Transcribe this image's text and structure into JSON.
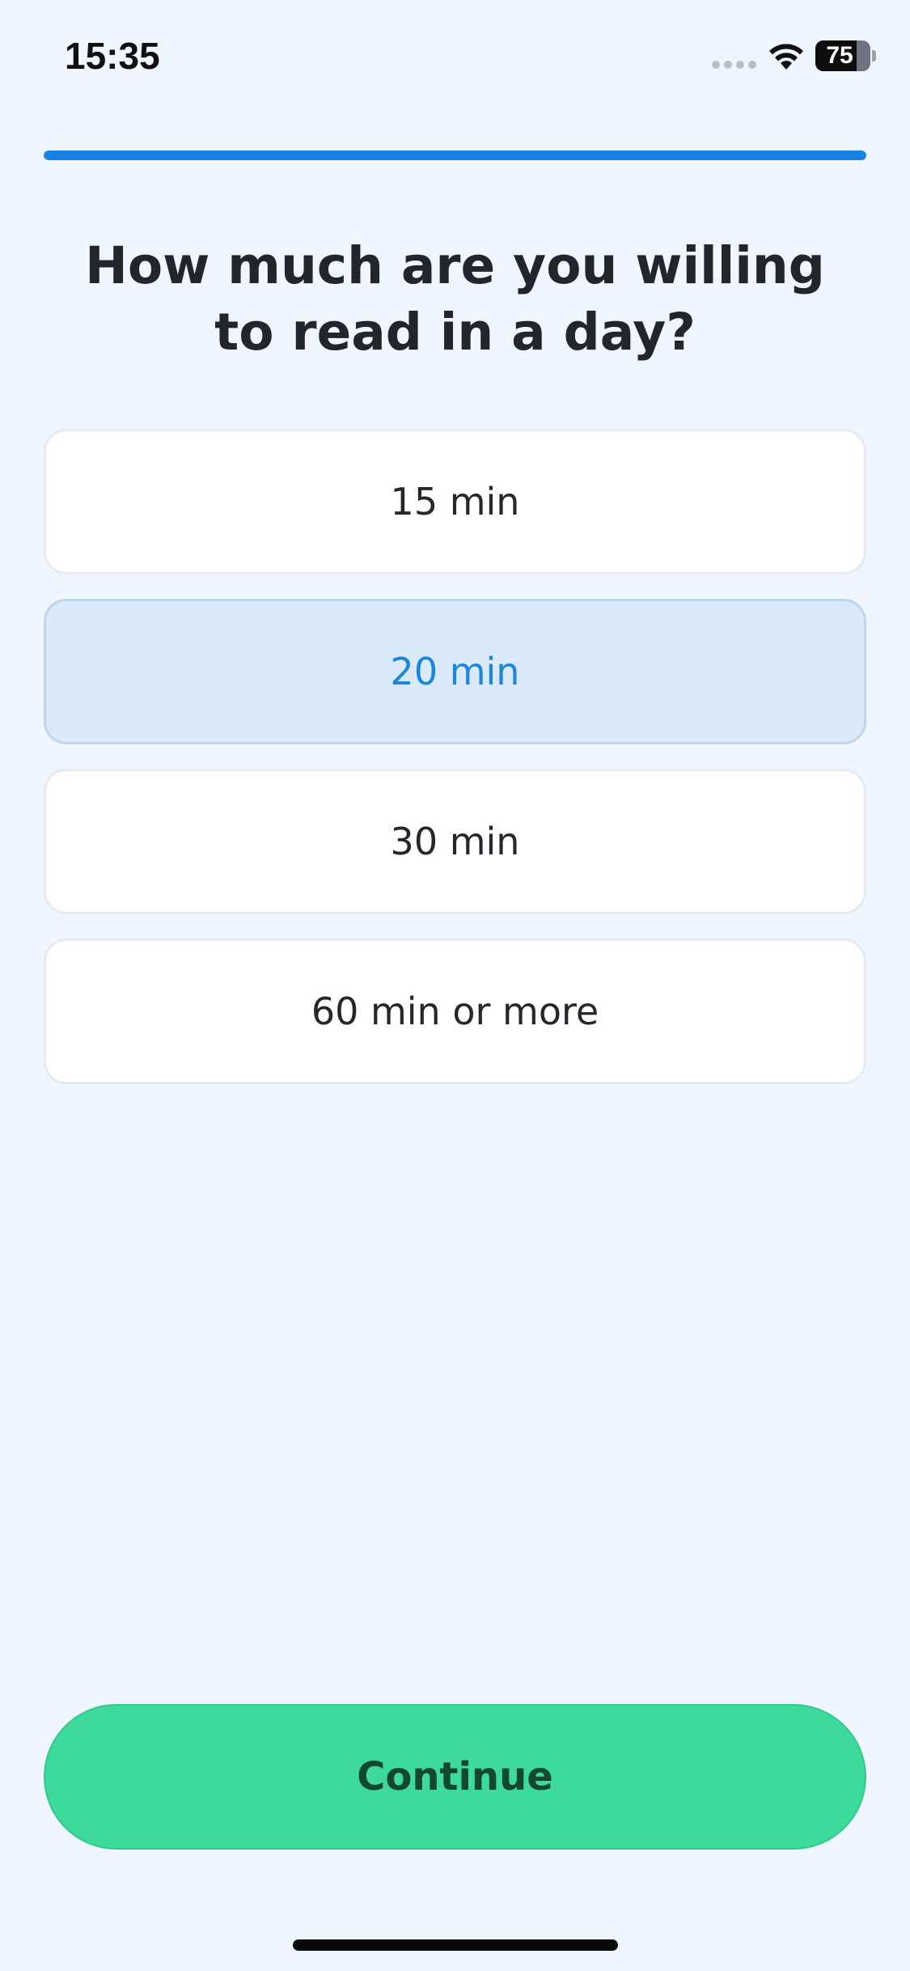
{
  "status_bar": {
    "time": "15:35",
    "battery_level": "75",
    "battery_fraction": 0.75,
    "icons": [
      "cellular-signal-icon",
      "wifi-icon",
      "battery-icon"
    ]
  },
  "progress": {
    "fraction": 1.0,
    "color": "#1A82E2"
  },
  "question": {
    "title": "How much are you willing to read in a day?"
  },
  "options": [
    {
      "label": "15 min",
      "selected": false
    },
    {
      "label": "20 min",
      "selected": true
    },
    {
      "label": "30 min",
      "selected": false
    },
    {
      "label": "60 min or more",
      "selected": false
    }
  ],
  "footer": {
    "continue_label": "Continue",
    "continue_color": "#3DDA9B"
  },
  "colors": {
    "background": "#EFF6FF",
    "accent": "#1A86DD",
    "selected_background": "#DAEAFB"
  }
}
